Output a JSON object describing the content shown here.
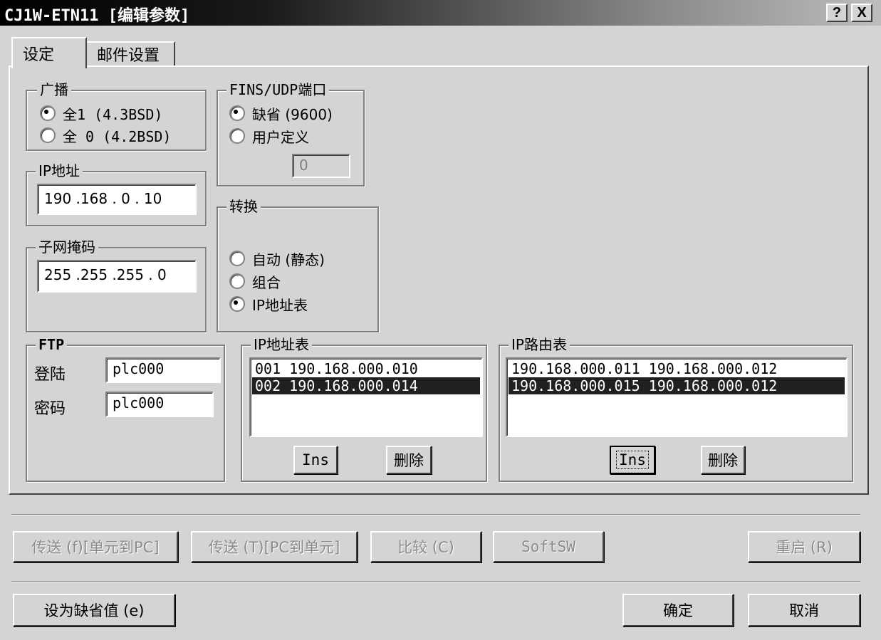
{
  "window": {
    "title": "CJ1W-ETN11 [编辑参数]",
    "help_btn": "?",
    "close_btn": "X"
  },
  "tabs": [
    {
      "label": "设定",
      "active": true
    },
    {
      "label": "邮件设置",
      "active": false
    }
  ],
  "broadcast": {
    "title": "广播",
    "options": [
      {
        "label": "全1 (4.3BSD)",
        "selected": true
      },
      {
        "label": "全 0 (4.2BSD)",
        "selected": false
      }
    ]
  },
  "fins_udp": {
    "title": "FINS/UDP端口",
    "options": [
      {
        "label": "缺省 (9600)",
        "selected": true
      },
      {
        "label": "用户定义",
        "selected": false
      }
    ],
    "value": "0"
  },
  "ip_address": {
    "title": "IP地址",
    "value": "190 .168 .  0  . 10"
  },
  "subnet": {
    "title": "子网掩码",
    "value": "255 .255 .255 .  0"
  },
  "conversion": {
    "title": "转换",
    "options": [
      {
        "label": "自动 (静态)",
        "selected": false
      },
      {
        "label": "组合",
        "selected": false
      },
      {
        "label": "IP地址表",
        "selected": true
      }
    ]
  },
  "ftp": {
    "title": "FTP",
    "login_label": "登陆",
    "login_value": "plc000",
    "password_label": "密码",
    "password_value": "plc000"
  },
  "ip_table": {
    "title": "IP地址表",
    "rows": [
      {
        "text": "001   190.168.000.010",
        "selected": false
      },
      {
        "text": "002   190.168.000.014",
        "selected": true
      }
    ],
    "ins": "Ins",
    "delete": "删除"
  },
  "ip_route": {
    "title": "IP路由表",
    "rows": [
      {
        "text": "190.168.000.011 190.168.000.012",
        "selected": false
      },
      {
        "text": "190.168.000.015 190.168.000.012",
        "selected": true
      }
    ],
    "ins": "Ins",
    "delete": "删除"
  },
  "actions": {
    "transfer_to_pc": "传送 (f)[单元到PC]",
    "transfer_to_unit": "传送 (T)[PC到单元]",
    "compare": "比较 (C)",
    "softsw": "SoftSW",
    "restart": "重启 (R)"
  },
  "footer": {
    "set_default": "设为缺省值 (e)",
    "ok": "确定",
    "cancel": "取消"
  }
}
